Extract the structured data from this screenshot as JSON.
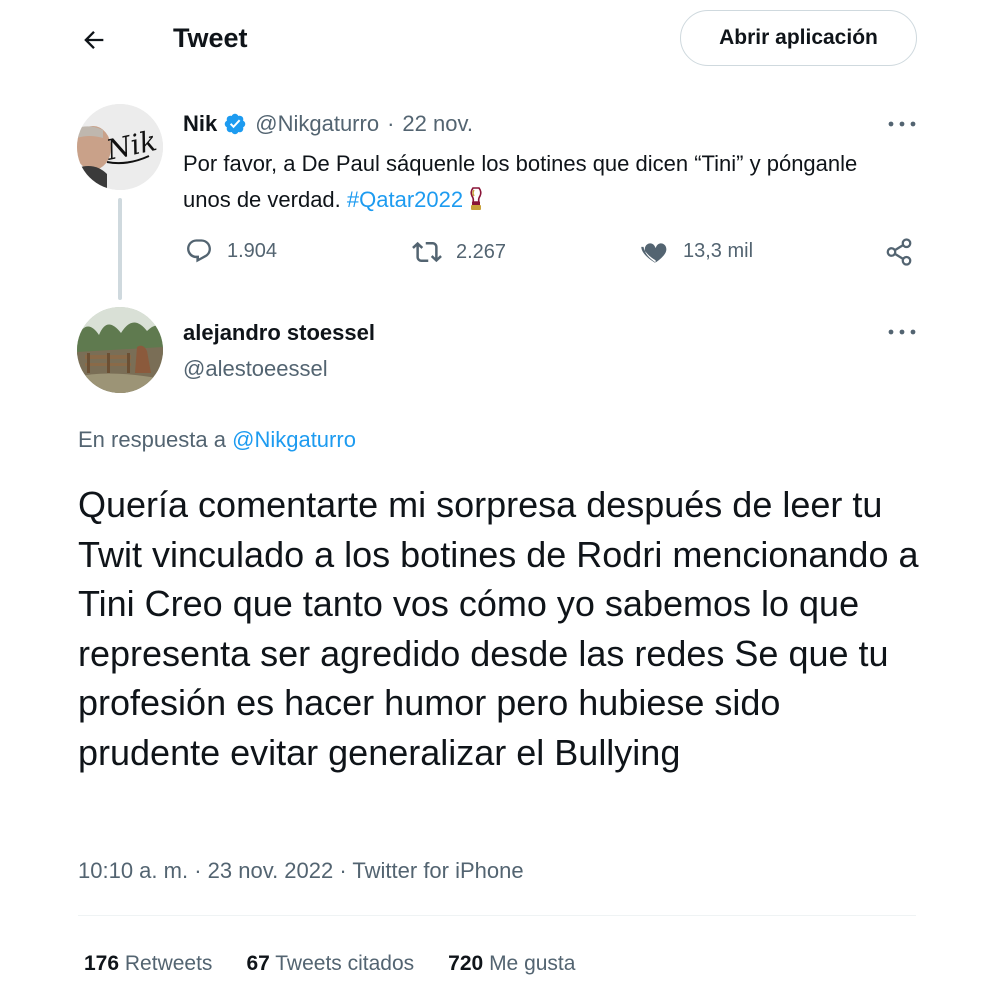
{
  "header": {
    "title": "Tweet",
    "open_app_label": "Abrir aplicación"
  },
  "parent_tweet": {
    "name": "Nik",
    "handle": "@Nikgaturro",
    "separator": "·",
    "date": "22 nov.",
    "text": "Por favor, a De Paul sáquenle los botines que dicen “Tini” y pónganle unos de verdad.",
    "hashtag": "#Qatar2022",
    "avatar_lettering": "Nik",
    "stats": {
      "replies": "1.904",
      "retweets": "2.267",
      "likes": "13,3 mil"
    }
  },
  "tweet": {
    "name": "alejandro stoessel",
    "handle": "@alestoeessel",
    "reply_prefix": "En respuesta a",
    "reply_to": "@Nikgaturro",
    "text": "Quería comentarte mi sorpresa después de leer tu Twit vinculado a los botines de Rodri mencionando a Tini Creo que tanto vos cómo yo sabemos lo que representa ser agredido desde las redes Se que tu profesión es hacer humor pero hubiese sido prudente evitar generalizar el Bullying",
    "time": "10:10 a. m.",
    "date": "23 nov. 2022",
    "source": "Twitter for iPhone",
    "separator": "·",
    "stats": [
      {
        "count": "176",
        "label": "Retweets"
      },
      {
        "count": "67",
        "label": "Tweets citados"
      },
      {
        "count": "720",
        "label": "Me gusta"
      }
    ]
  },
  "colors": {
    "text": "#0f1419",
    "muted": "#536471",
    "accent": "#1d9bf0",
    "border": "#cfd9de"
  },
  "icons": {
    "back": "arrow-left-icon",
    "verified": "verified-badge-icon",
    "more": "more-dots-icon",
    "reply": "comment-icon",
    "retweet": "retweet-icon",
    "like": "heart-icon",
    "share": "share-icon",
    "emoji": "trophy-emoji-icon"
  }
}
